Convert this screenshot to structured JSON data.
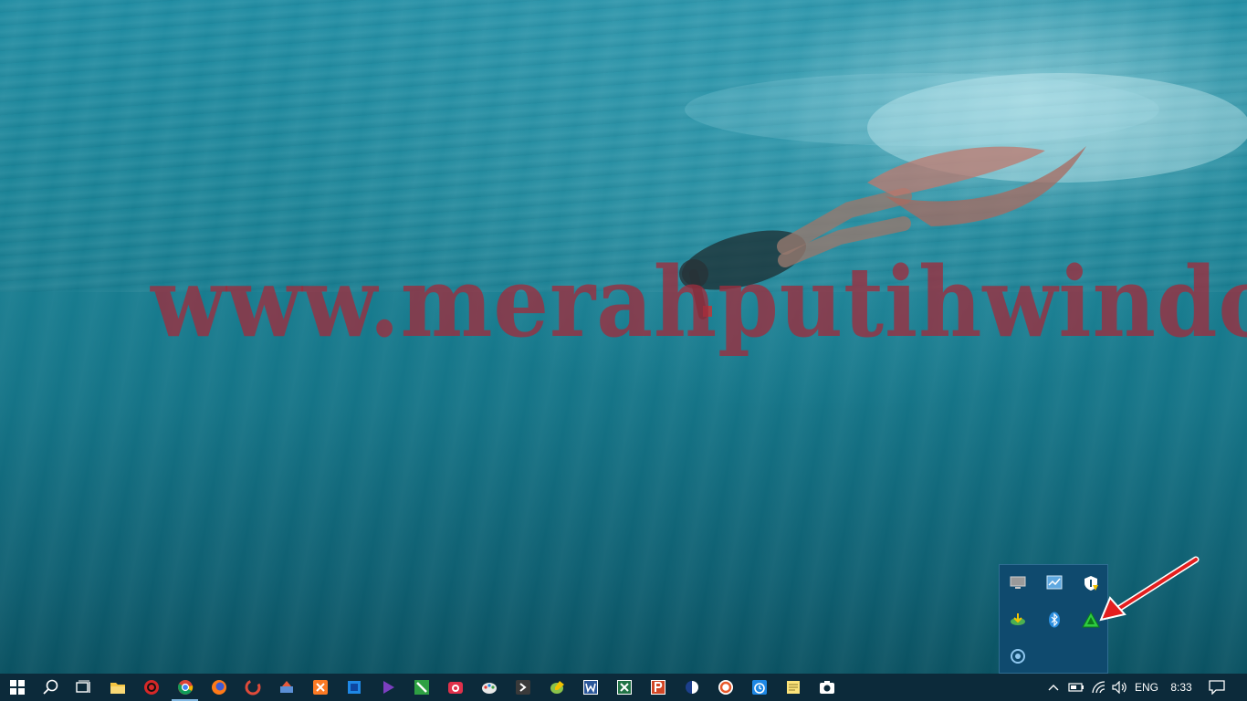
{
  "desktop": {
    "wallpaper": "underwater-freediver",
    "watermark_text": "www.merahputihwindows.net"
  },
  "tray_flyout": {
    "icons": [
      {
        "name": "display-icon",
        "color": "#c8c8c8"
      },
      {
        "name": "network-monitor-icon",
        "color": "#5fa8e0"
      },
      {
        "name": "windows-security-icon",
        "color": "#ffffff"
      },
      {
        "name": "internet-download-manager-icon",
        "color": "#4caf50"
      },
      {
        "name": "bluetooth-icon",
        "color": "#2b8fe0"
      },
      {
        "name": "green-triangle-app-icon",
        "color": "#2ecc40"
      },
      {
        "name": "sync-circle-icon",
        "color": "#8fc7ef"
      }
    ]
  },
  "taskbar": {
    "apps": [
      {
        "name": "start-icon"
      },
      {
        "name": "search-icon"
      },
      {
        "name": "task-view-icon"
      },
      {
        "name": "file-explorer-icon"
      },
      {
        "name": "red-circle-app-icon"
      },
      {
        "name": "chrome-icon"
      },
      {
        "name": "firefox-icon"
      },
      {
        "name": "ccleaner-icon"
      },
      {
        "name": "tool-app-icon"
      },
      {
        "name": "xampp-icon"
      },
      {
        "name": "blue-square-app-icon"
      },
      {
        "name": "media-player-icon"
      },
      {
        "name": "green-app-icon"
      },
      {
        "name": "camera-app-icon"
      },
      {
        "name": "paint-icon"
      },
      {
        "name": "terminal-app-icon"
      },
      {
        "name": "notepad-plus-plus-icon"
      },
      {
        "name": "word-icon"
      },
      {
        "name": "excel-icon"
      },
      {
        "name": "powerpoint-icon"
      },
      {
        "name": "blue-orb-app-icon"
      },
      {
        "name": "orange-circle-app-icon"
      },
      {
        "name": "alarm-clock-icon"
      },
      {
        "name": "sticky-notes-icon"
      },
      {
        "name": "snipping-tool-icon"
      }
    ],
    "tray": {
      "language": "ENG",
      "time": "8:33"
    }
  },
  "colors": {
    "taskbar_bg": "#0c2a3a",
    "flyout_bg": "#0f4a6e",
    "watermark": "#9e2d3e",
    "arrow": "#e41e1e"
  }
}
